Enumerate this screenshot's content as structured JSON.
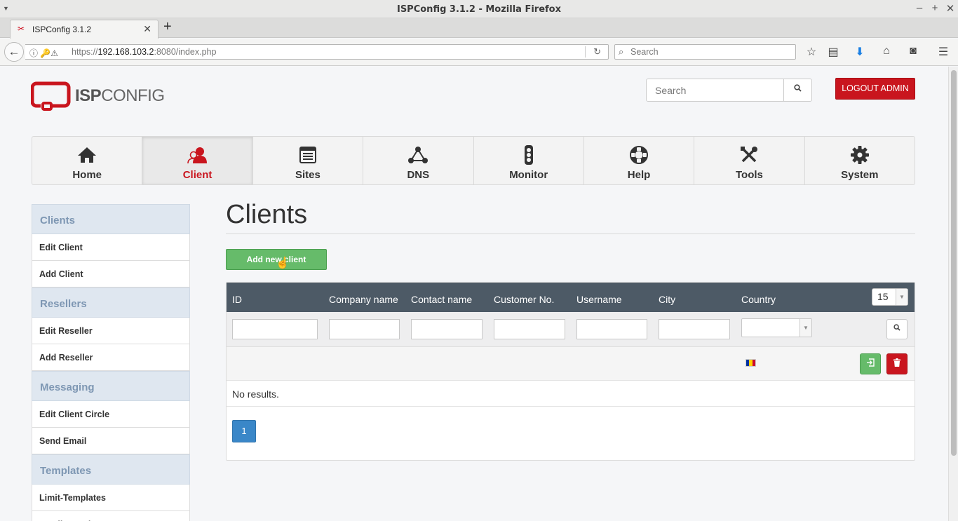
{
  "window": {
    "title": "ISPConfig 3.1.2 - Mozilla Firefox"
  },
  "tab": {
    "title": "ISPConfig 3.1.2"
  },
  "urlbar": {
    "url_host": "192.168.103.2",
    "url_prefix": "https://",
    "url_suffix": ":8080/index.php"
  },
  "browser_search": {
    "placeholder": "Search"
  },
  "header": {
    "logo_bold": "ISP",
    "logo_rest": "CONFIG",
    "search_placeholder": "Search",
    "logout_label": "LOGOUT ADMIN"
  },
  "nav": {
    "items": [
      {
        "label": "Home",
        "icon": "home-icon"
      },
      {
        "label": "Client",
        "icon": "client-icon",
        "active": true
      },
      {
        "label": "Sites",
        "icon": "sites-icon"
      },
      {
        "label": "DNS",
        "icon": "dns-icon"
      },
      {
        "label": "Monitor",
        "icon": "monitor-icon"
      },
      {
        "label": "Help",
        "icon": "help-icon"
      },
      {
        "label": "Tools",
        "icon": "tools-icon"
      },
      {
        "label": "System",
        "icon": "system-icon"
      }
    ]
  },
  "sidebar": {
    "clients": "Clients",
    "edit_client": "Edit Client",
    "add_client": "Add Client",
    "resellers": "Resellers",
    "edit_reseller": "Edit Reseller",
    "add_reseller": "Add Reseller",
    "messaging": "Messaging",
    "edit_client_circle": "Edit Client Circle",
    "send_email": "Send Email",
    "templates": "Templates",
    "limit_templates": "Limit-Templates",
    "email_templates": "Email-Templates"
  },
  "main": {
    "title": "Clients",
    "add_button": "Add new client",
    "columns": [
      "ID",
      "Company name",
      "Contact name",
      "Customer No.",
      "Username",
      "City",
      "Country"
    ],
    "per_page": "15",
    "no_results": "No results.",
    "page": "1"
  },
  "colors": {
    "accent_red": "#c9151e",
    "green": "#66bb6a",
    "header_dark": "#4d5a66",
    "pagination_blue": "#3a87c8"
  }
}
